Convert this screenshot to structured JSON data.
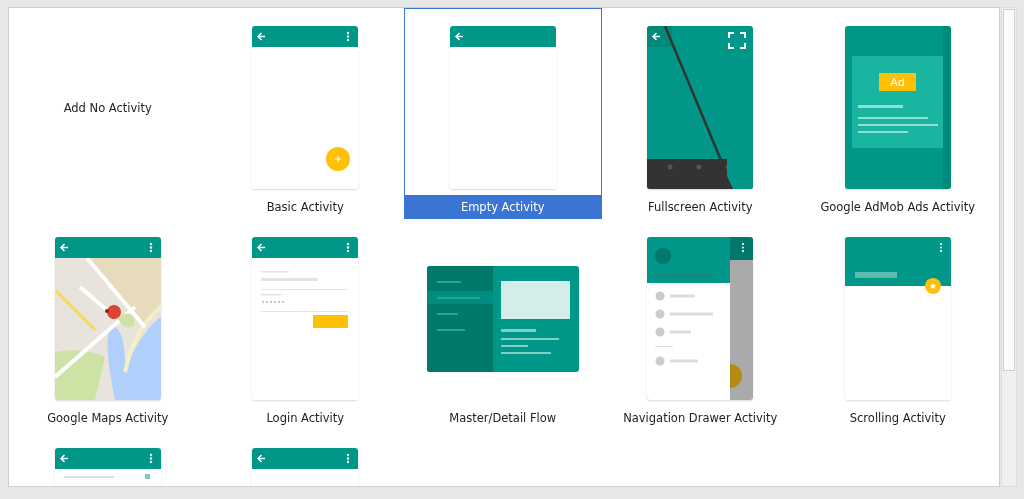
{
  "templates": [
    {
      "kind": "none",
      "label": "Add No Activity",
      "selected": false
    },
    {
      "kind": "basic",
      "label": "Basic Activity",
      "selected": false
    },
    {
      "kind": "empty",
      "label": "Empty Activity",
      "selected": true
    },
    {
      "kind": "fullscreen",
      "label": "Fullscreen Activity",
      "selected": false
    },
    {
      "kind": "admob",
      "label": "Google AdMob Ads Activity",
      "selected": false,
      "badge": "Ad"
    },
    {
      "kind": "maps",
      "label": "Google Maps Activity",
      "selected": false
    },
    {
      "kind": "login",
      "label": "Login Activity",
      "selected": false
    },
    {
      "kind": "master_detail",
      "label": "Master/Detail Flow",
      "selected": false
    },
    {
      "kind": "nav_drawer",
      "label": "Navigation Drawer Activity",
      "selected": false
    },
    {
      "kind": "scrolling",
      "label": "Scrolling Activity",
      "selected": false
    },
    {
      "kind": "list_bar",
      "selected": false
    },
    {
      "kind": "plain_bar",
      "selected": false
    }
  ]
}
